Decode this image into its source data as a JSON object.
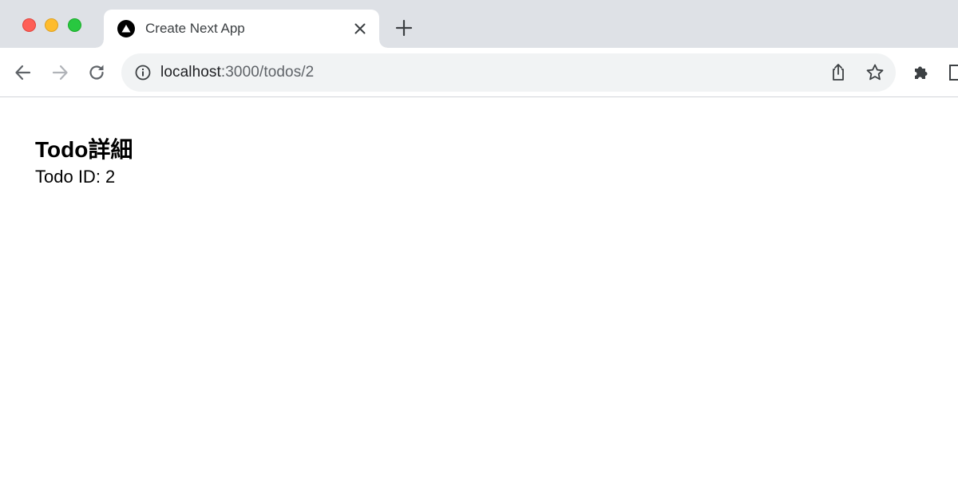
{
  "browser": {
    "tab": {
      "title": "Create Next App",
      "favicon": "nextjs-triangle-icon"
    },
    "address_bar": {
      "host": "localhost",
      "path": ":3000/todos/2"
    },
    "icons": {
      "back": "arrow-left-icon",
      "forward": "arrow-right-icon",
      "reload": "reload-icon",
      "info": "info-icon",
      "share": "share-icon",
      "bookmark": "star-icon",
      "extensions": "puzzle-icon",
      "side_panel": "side-panel-icon",
      "new_tab": "plus-icon",
      "close_tab": "close-icon"
    },
    "colors": {
      "tabstrip": "#dee1e6",
      "omnibox": "#f1f3f4",
      "traffic_red": "#fe5f57",
      "traffic_yellow": "#febc2e",
      "traffic_green": "#28c840"
    }
  },
  "page": {
    "title": "Todo詳細",
    "todo_id_text": "Todo ID: 2"
  }
}
